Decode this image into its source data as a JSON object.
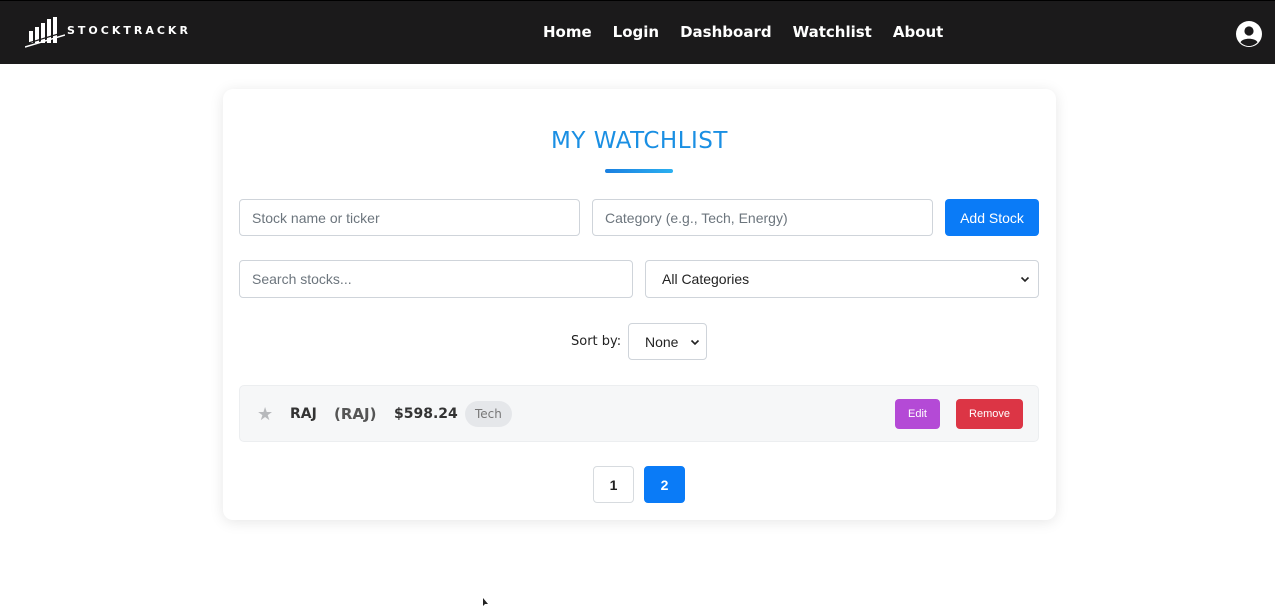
{
  "navbar": {
    "logo_text": "STOCKTRACKR",
    "links": [
      "Home",
      "Login",
      "Dashboard",
      "Watchlist",
      "About"
    ],
    "account_icon": "user-circle-icon"
  },
  "watchlist": {
    "title": "MY WATCHLIST",
    "add_form": {
      "stock_placeholder": "Stock name or ticker",
      "category_placeholder": "Category (e.g., Tech, Energy)",
      "add_button": "Add Stock"
    },
    "filter": {
      "search_placeholder": "Search stocks...",
      "category_selected": "All Categories"
    },
    "sort": {
      "label": "Sort by:",
      "selected": "None"
    },
    "stocks": [
      {
        "favorite_icon": "star-icon",
        "favorite": false,
        "name": "RAJ",
        "ticker": "(RAJ)",
        "price": "$598.24",
        "category": "Tech",
        "edit_label": "Edit",
        "remove_label": "Remove"
      }
    ],
    "pagination": {
      "pages": [
        "1",
        "2"
      ],
      "current": "2"
    }
  },
  "colors": {
    "navbar_bg": "#1b1a1b",
    "title": "#1a8fe3",
    "primary": "#0a7bf7",
    "edit": "#b44ad6",
    "remove": "#dc3545"
  }
}
